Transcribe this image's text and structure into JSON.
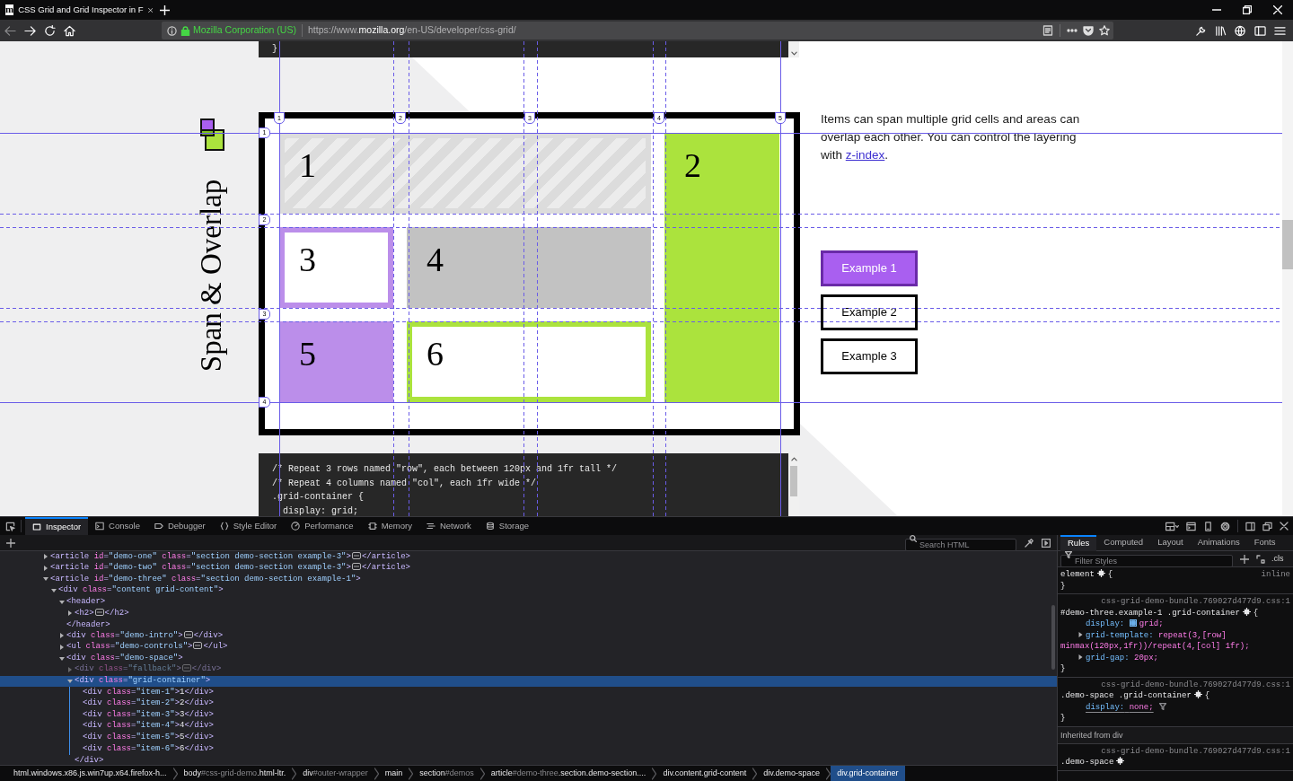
{
  "browser": {
    "tab": {
      "favicon": "m",
      "title": "CSS Grid and Grid Inspector in F"
    },
    "identity": "Mozilla Corporation (US)",
    "url": {
      "prefix": "https://www.",
      "domain": "mozilla.org",
      "path": "/en-US/developer/css-grid/"
    }
  },
  "page": {
    "code_top": [
      "}"
    ],
    "heading": "Span & Overlap",
    "column_lines": [
      "1",
      "2",
      "3",
      "4",
      "5"
    ],
    "row_lines": [
      "1",
      "2",
      "3",
      "4"
    ],
    "grid_items": [
      {
        "label": "1",
        "kind": "hatched",
        "color": "#dcdcdc"
      },
      {
        "label": "2",
        "kind": "filled",
        "color": "#abe33d"
      },
      {
        "label": "3",
        "kind": "outlined",
        "color": "#bb8eea"
      },
      {
        "label": "4",
        "kind": "filled",
        "color": "#c2c2c2"
      },
      {
        "label": "5",
        "kind": "filled",
        "color": "#bb8eea"
      },
      {
        "label": "6",
        "kind": "outlined",
        "color": "#abe33d"
      }
    ],
    "description": {
      "text": "Items can span multiple grid cells and areas can overlap each other. You can control the layering with",
      "link": "z-index",
      "end": "."
    },
    "examples": [
      {
        "label": "Example 1",
        "selected": true
      },
      {
        "label": "Example 2",
        "selected": false
      },
      {
        "label": "Example 3",
        "selected": false
      }
    ],
    "code_bottom": [
      "/* Repeat 3 rows named \"row\", each between 120px and 1fr tall */",
      "/* Repeat 4 columns named \"col\", each 1fr wide */",
      ".grid-container {",
      "  display: grid;"
    ]
  },
  "devtools": {
    "tools": [
      {
        "label": "Inspector",
        "selected": true
      },
      {
        "label": "Console",
        "selected": false
      },
      {
        "label": "Debugger",
        "selected": false
      },
      {
        "label": "Style Editor",
        "selected": false
      },
      {
        "label": "Performance",
        "selected": false
      },
      {
        "label": "Memory",
        "selected": false
      },
      {
        "label": "Network",
        "selected": false
      },
      {
        "label": "Storage",
        "selected": false
      }
    ],
    "search": {
      "placeholder": "Search HTML"
    },
    "markup": [
      {
        "open": "<article id=\"demo-one\" class=\"section demo-section example-3\">",
        "close": "</article>",
        "expanded": false,
        "selected": false,
        "dimmed": false
      },
      {
        "open": "<article id=\"demo-two\" class=\"section demo-section example-3\">",
        "close": "</article>",
        "expanded": false,
        "selected": false,
        "dimmed": false
      },
      {
        "open": "<article id=\"demo-three\" class=\"section demo-section example-1\">",
        "expanded": true,
        "selected": false,
        "dimmed": false,
        "children": [
          {
            "open": "<div class=\"content grid-content\">",
            "expanded": true,
            "selected": false,
            "dimmed": false,
            "children": [
              {
                "open": "<header>",
                "close": "</header>",
                "expanded": true,
                "selected": false,
                "dimmed": false,
                "children": [
                  {
                    "open": "<h2>",
                    "close": "</h2>",
                    "expanded": false,
                    "selected": false,
                    "dimmed": false
                  }
                ]
              },
              {
                "open": "<div class=\"demo-intro\">",
                "close": "</div>",
                "expanded": false,
                "selected": false,
                "dimmed": false
              },
              {
                "open": "<ul class=\"demo-controls\">",
                "close": "</ul>",
                "expanded": false,
                "selected": false,
                "dimmed": false
              },
              {
                "open": "<div class=\"demo-space\">",
                "expanded": true,
                "selected": false,
                "dimmed": false,
                "children": [
                  {
                    "open": "<div class=\"fallback\">",
                    "close": "</div>",
                    "expanded": false,
                    "selected": false,
                    "dimmed": true
                  },
                  {
                    "open": "<div class=\"grid-container\">",
                    "close": "</div>",
                    "expanded": true,
                    "selected": true,
                    "dimmed": false,
                    "children": [
                      {
                        "open": "<div class=\"item-1\">",
                        "text": "1",
                        "close": "</div>",
                        "selected": false,
                        "dimmed": false
                      },
                      {
                        "open": "<div class=\"item-2\">",
                        "text": "2",
                        "close": "</div>",
                        "selected": false,
                        "dimmed": false
                      },
                      {
                        "open": "<div class=\"item-3\">",
                        "text": "3",
                        "close": "</div>",
                        "selected": false,
                        "dimmed": false
                      },
                      {
                        "open": "<div class=\"item-4\">",
                        "text": "4",
                        "close": "</div>",
                        "selected": false,
                        "dimmed": false
                      },
                      {
                        "open": "<div class=\"item-5\">",
                        "text": "5",
                        "close": "</div>",
                        "selected": false,
                        "dimmed": false
                      },
                      {
                        "open": "<div class=\"item-6\">",
                        "text": "6",
                        "close": "</div>",
                        "selected": false,
                        "dimmed": false
                      }
                    ]
                  }
                ]
              }
            ]
          }
        ]
      }
    ],
    "breadcrumbs": [
      {
        "tag": "html",
        "classes": ".windows.x86.js.win7up.x64.firefox-h...",
        "selected": false
      },
      {
        "tag": "body",
        "id": "#css-grid-demo",
        "classes": ".html-ltr.",
        "selected": false
      },
      {
        "tag": "div",
        "id": "#outer-wrapper",
        "selected": false
      },
      {
        "tag": "main",
        "selected": false
      },
      {
        "tag": "section",
        "id": "#demos",
        "selected": false
      },
      {
        "tag": "article",
        "id": "#demo-three",
        "classes": ".section.demo-section....",
        "selected": false
      },
      {
        "tag": "div",
        "classes": ".content.grid-content",
        "selected": false
      },
      {
        "tag": "div",
        "classes": ".demo-space",
        "selected": false
      },
      {
        "tag": "div",
        "classes": ".grid-container",
        "selected": true
      }
    ],
    "sidebar": {
      "tabs": [
        {
          "label": "Rules",
          "selected": true
        },
        {
          "label": "Computed",
          "selected": false
        },
        {
          "label": "Layout",
          "selected": false
        },
        {
          "label": "Animations",
          "selected": false
        },
        {
          "label": "Fonts",
          "selected": false
        }
      ],
      "filter": {
        "placeholder": "Filter Styles"
      },
      "cls": ".cls",
      "rules": [
        {
          "selector": "element",
          "source": "inline",
          "open": "{",
          "close": "}"
        },
        {
          "selector": "#demo-three.example-1 .grid-container",
          "source": "css-grid-demo-bundle.769027d477d9.css:1",
          "open": "{",
          "close": "}",
          "declarations": [
            {
              "name": "display:",
              "value": "grid;",
              "kind": "grid",
              "overridden": false
            },
            {
              "name": "grid-template:",
              "value": "repeat(3,[row] minmax(120px,1fr))/repeat(4,[col] 1fr);",
              "kind": "shorthand",
              "overridden": false
            },
            {
              "name": "grid-gap:",
              "value": "20px;",
              "kind": "shorthand",
              "overridden": false
            }
          ]
        },
        {
          "selector": ".demo-space .grid-container",
          "source": "css-grid-demo-bundle.769027d477d9.css:1",
          "open": "{",
          "close": "}",
          "declarations": [
            {
              "name": "display:",
              "value": "none;",
              "kind": "plain",
              "overridden": true
            }
          ]
        }
      ],
      "inherited": {
        "title": "Inherited from div",
        "rules": [
          {
            "selector": ".demo-space",
            "source": "css-grid-demo-bundle.769027d477d9.css:1"
          }
        ]
      }
    }
  }
}
